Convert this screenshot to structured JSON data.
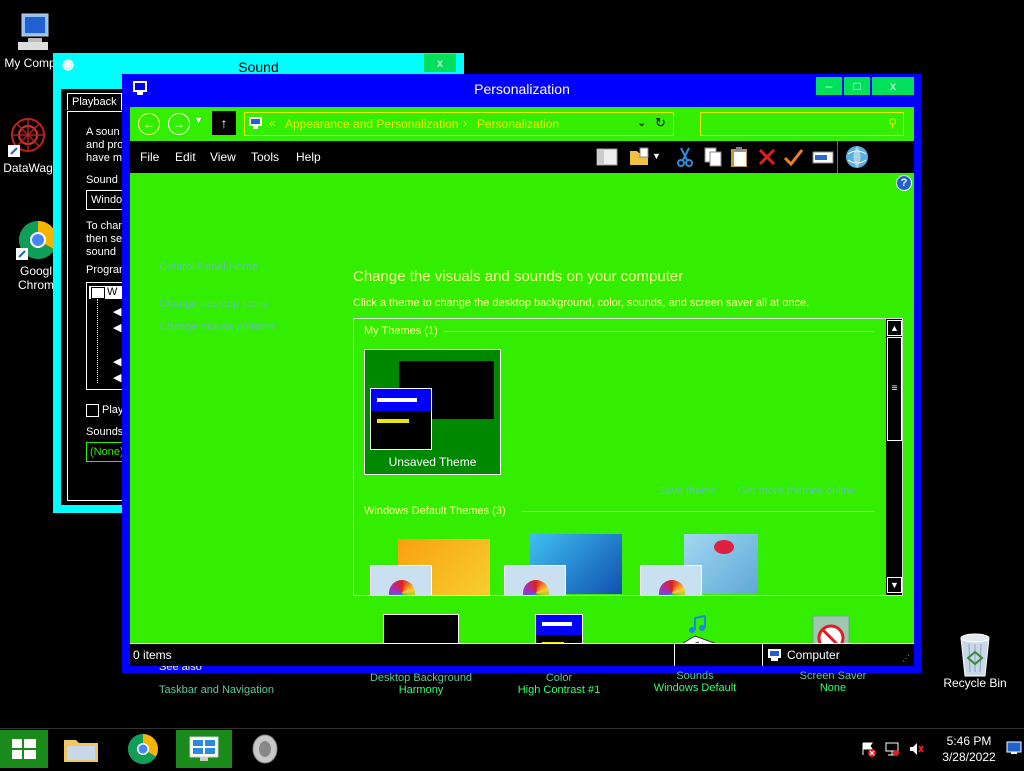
{
  "desktop": {
    "icons": [
      {
        "label": "My Comp"
      },
      {
        "label": "DataWag"
      },
      {
        "label": "Googl Chrom"
      },
      {
        "label": "Recycle Bin"
      }
    ]
  },
  "sound_window": {
    "title": "Sound",
    "close": "x",
    "tab": "Playback",
    "text_lines": [
      "A soun",
      "and pro",
      "have m"
    ],
    "sound_label": "Sound",
    "scheme_value": "Windo",
    "instr_lines": [
      "To chan",
      "then se",
      "sound"
    ],
    "program_label": "Progran",
    "tree_first": "W",
    "play_checkbox": "Play",
    "sounds_label": "Sounds",
    "sounds_value": "(None)"
  },
  "window": {
    "title": "Personalization",
    "min": "–",
    "max": "□",
    "close": "x"
  },
  "address": {
    "prefix": "«",
    "crumb1": "Appearance and Personalization",
    "sep": "›",
    "crumb2": "Personalization"
  },
  "menu": [
    "File",
    "Edit",
    "View",
    "Tools",
    "Help"
  ],
  "toolbar": {
    "icons": [
      "layout-icon",
      "folder-options-icon",
      "cut-icon",
      "copy-icon",
      "paste-icon",
      "delete-icon",
      "check-icon",
      "rename-icon",
      "globe-icon"
    ]
  },
  "left_pane": {
    "home": "Control Panel Home",
    "links": [
      "Change desktop icons",
      "Change mouse pointers"
    ],
    "see_also": "See also",
    "see_also_links": [
      "Taskbar and Navigation"
    ]
  },
  "main": {
    "heading": "Change the visuals and sounds on your computer",
    "subheading": "Click a theme to change the desktop background, color, sounds, and screen saver all at once.",
    "my_themes": "My Themes (1)",
    "unsaved_theme": "Unsaved Theme",
    "save_theme": "Save theme",
    "get_more": "Get more themes online",
    "default_themes": "Windows Default Themes (3)"
  },
  "bottom_items": [
    {
      "label": "Desktop Background",
      "sub": "Harmony"
    },
    {
      "label": "Color",
      "sub": "High Contrast #1"
    },
    {
      "label": "Sounds",
      "sub": "Windows Default"
    },
    {
      "label": "Screen Saver",
      "sub": "None"
    }
  ],
  "status": {
    "items": "0 items",
    "location": "Computer"
  },
  "taskbar": {
    "time": "5:46 PM",
    "date": "3/28/2022"
  },
  "colors": {
    "window_frame": "#0000ff",
    "content_bg": "#33ee00",
    "heading": "#ffff99",
    "accent_yellow": "#e8e800",
    "sound_frame": "#00ffff"
  }
}
